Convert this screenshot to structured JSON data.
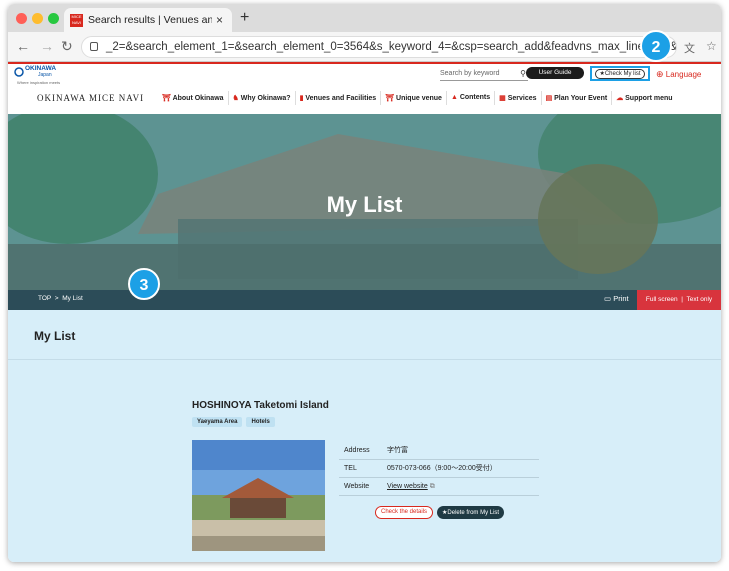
{
  "browser": {
    "tab_title": "Search results | Venues and Fa",
    "tab_favicon_text": "MICE NAVI",
    "close_glyph": "×",
    "newtab_glyph": "+",
    "url": "_2=&search_element_1=&search_element_0=3564&s_keyword_4=&csp=search_add&feadvns_max_line_8=5&fe_form",
    "nav_icons": [
      "back-icon",
      "forward-icon",
      "reload-icon",
      "lock-icon",
      "translate-icon",
      "star-icon"
    ],
    "traffic_colors": [
      "#ff5f57",
      "#febc2e",
      "#28c840"
    ]
  },
  "header": {
    "logo_main": "OKINAWA",
    "logo_sub": "Japan",
    "logo_tag": "Where inspiration meets",
    "search_placeholder": "Search by keyword",
    "user_guide": "User Guide",
    "check_my_list": "★Check My list",
    "language": "Language",
    "brand": "OKINAWA MICE NAVI"
  },
  "menu": [
    {
      "label": "About Okinawa"
    },
    {
      "label": "Why Okinawa?"
    },
    {
      "label": "Venues and Facilities"
    },
    {
      "label": "Unique venue"
    },
    {
      "label": "Contents"
    },
    {
      "label": "Services"
    },
    {
      "label": "Plan Your Event"
    },
    {
      "label": "Support menu"
    }
  ],
  "hero": {
    "title": "My List"
  },
  "breadcrumb": {
    "top": "TOP",
    "sep": ">",
    "current": "My List",
    "print": "Print",
    "fullscreen": "Full screen",
    "divider": "|",
    "textonly": "Text only"
  },
  "page": {
    "title": "My List"
  },
  "item": {
    "name": "HOSHINOYA Taketomi Island",
    "tags": [
      "Yaeyama Area",
      "Hotels"
    ],
    "rows": [
      {
        "label": "Address",
        "value": "字竹富"
      },
      {
        "label": "TEL",
        "value": "0570-073-066（9:00～20:00受付）"
      },
      {
        "label": "Website",
        "value": "View website"
      }
    ],
    "check_details": "Check the details",
    "delete_label": "★Delete from My List"
  },
  "callouts": {
    "badge2": "2",
    "badge3": "3"
  },
  "colors": {
    "accent_red": "#d8281e",
    "callout_blue": "#1ca0e6",
    "breadcrumb_bar": "#2c4c58",
    "panel_bg": "#d7eef9"
  }
}
